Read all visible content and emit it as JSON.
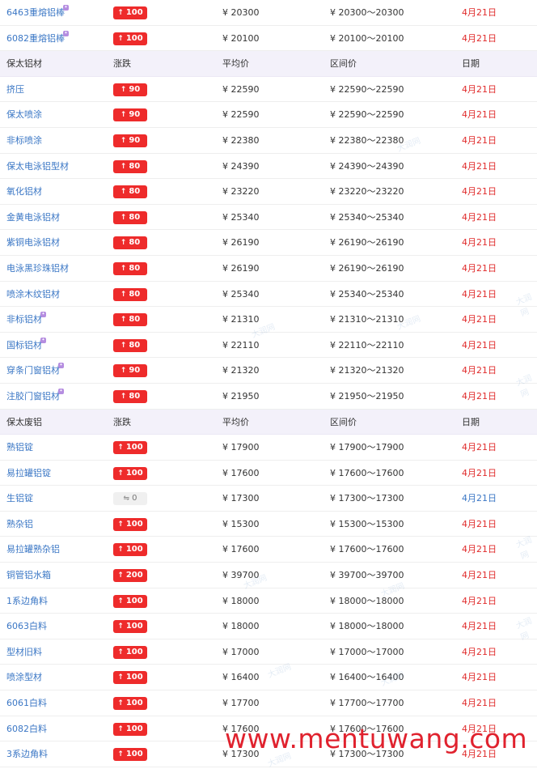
{
  "groups": [
    {
      "header": null,
      "rows": [
        {
          "name": "6463重熔铝棒",
          "vip": true,
          "change": "100",
          "dir": "up",
          "avg": "¥ 20300",
          "range": "¥ 20300～20300",
          "date": "4月21日"
        },
        {
          "name": "6082重熔铝棒",
          "vip": true,
          "change": "100",
          "dir": "up",
          "avg": "¥ 20100",
          "range": "¥ 20100～20100",
          "date": "4月21日"
        }
      ]
    },
    {
      "header": {
        "name": "保太铝材",
        "change": "涨跌",
        "avg": "平均价",
        "range": "区间价",
        "date": "日期"
      },
      "rows": [
        {
          "name": "挤压",
          "vip": false,
          "change": "90",
          "dir": "up",
          "avg": "¥ 22590",
          "range": "¥ 22590～22590",
          "date": "4月21日"
        },
        {
          "name": "保太喷涂",
          "vip": false,
          "change": "90",
          "dir": "up",
          "avg": "¥ 22590",
          "range": "¥ 22590～22590",
          "date": "4月21日"
        },
        {
          "name": "非标喷涂",
          "vip": false,
          "change": "90",
          "dir": "up",
          "avg": "¥ 22380",
          "range": "¥ 22380～22380",
          "date": "4月21日"
        },
        {
          "name": "保太电泳铝型材",
          "vip": false,
          "change": "80",
          "dir": "up",
          "avg": "¥ 24390",
          "range": "¥ 24390～24390",
          "date": "4月21日"
        },
        {
          "name": "氧化铝材",
          "vip": false,
          "change": "80",
          "dir": "up",
          "avg": "¥ 23220",
          "range": "¥ 23220～23220",
          "date": "4月21日"
        },
        {
          "name": "金黄电泳铝材",
          "vip": false,
          "change": "80",
          "dir": "up",
          "avg": "¥ 25340",
          "range": "¥ 25340～25340",
          "date": "4月21日"
        },
        {
          "name": "紫铜电泳铝材",
          "vip": false,
          "change": "80",
          "dir": "up",
          "avg": "¥ 26190",
          "range": "¥ 26190～26190",
          "date": "4月21日"
        },
        {
          "name": "电泳黑珍珠铝材",
          "vip": false,
          "change": "80",
          "dir": "up",
          "avg": "¥ 26190",
          "range": "¥ 26190～26190",
          "date": "4月21日"
        },
        {
          "name": "喷涂木纹铝材",
          "vip": false,
          "change": "80",
          "dir": "up",
          "avg": "¥ 25340",
          "range": "¥ 25340～25340",
          "date": "4月21日"
        },
        {
          "name": "非标铝材",
          "vip": true,
          "change": "80",
          "dir": "up",
          "avg": "¥ 21310",
          "range": "¥ 21310～21310",
          "date": "4月21日"
        },
        {
          "name": "国标铝材",
          "vip": true,
          "change": "80",
          "dir": "up",
          "avg": "¥ 22110",
          "range": "¥ 22110～22110",
          "date": "4月21日"
        },
        {
          "name": "穿条门窗铝材",
          "vip": true,
          "change": "90",
          "dir": "up",
          "avg": "¥ 21320",
          "range": "¥ 21320～21320",
          "date": "4月21日"
        },
        {
          "name": "注胶门窗铝材",
          "vip": true,
          "change": "80",
          "dir": "up",
          "avg": "¥ 21950",
          "range": "¥ 21950～21950",
          "date": "4月21日"
        }
      ]
    },
    {
      "header": {
        "name": "保太废铝",
        "change": "涨跌",
        "avg": "平均价",
        "range": "区间价",
        "date": "日期"
      },
      "rows": [
        {
          "name": "熟铝锭",
          "vip": false,
          "change": "100",
          "dir": "up",
          "avg": "¥ 17900",
          "range": "¥ 17900～17900",
          "date": "4月21日"
        },
        {
          "name": "易拉罐铝锭",
          "vip": false,
          "change": "100",
          "dir": "up",
          "avg": "¥ 17600",
          "range": "¥ 17600～17600",
          "date": "4月21日"
        },
        {
          "name": "生铝锭",
          "vip": false,
          "change": "0",
          "dir": "flat",
          "avg": "¥ 17300",
          "range": "¥ 17300～17300",
          "date": "4月21日"
        },
        {
          "name": "熟杂铝",
          "vip": false,
          "change": "100",
          "dir": "up",
          "avg": "¥ 15300",
          "range": "¥ 15300～15300",
          "date": "4月21日"
        },
        {
          "name": "易拉罐熟杂铝",
          "vip": false,
          "change": "100",
          "dir": "up",
          "avg": "¥ 17600",
          "range": "¥ 17600～17600",
          "date": "4月21日"
        },
        {
          "name": "铜管铝水箱",
          "vip": false,
          "change": "200",
          "dir": "up",
          "avg": "¥ 39700",
          "range": "¥ 39700～39700",
          "date": "4月21日"
        },
        {
          "name": "1系边角料",
          "vip": false,
          "change": "100",
          "dir": "up",
          "avg": "¥ 18000",
          "range": "¥ 18000～18000",
          "date": "4月21日"
        },
        {
          "name": "6063白料",
          "vip": false,
          "change": "100",
          "dir": "up",
          "avg": "¥ 18000",
          "range": "¥ 18000～18000",
          "date": "4月21日"
        },
        {
          "name": "型材旧料",
          "vip": false,
          "change": "100",
          "dir": "up",
          "avg": "¥ 17000",
          "range": "¥ 17000～17000",
          "date": "4月21日"
        },
        {
          "name": "喷涂型材",
          "vip": false,
          "change": "100",
          "dir": "up",
          "avg": "¥ 16400",
          "range": "¥ 16400～16400",
          "date": "4月21日"
        },
        {
          "name": "6061白料",
          "vip": false,
          "change": "100",
          "dir": "up",
          "avg": "¥ 17700",
          "range": "¥ 17700～17700",
          "date": "4月21日"
        },
        {
          "name": "6082白料",
          "vip": false,
          "change": "100",
          "dir": "up",
          "avg": "¥ 17600",
          "range": "¥ 17600～17600",
          "date": "4月21日"
        },
        {
          "name": "3系边角料",
          "vip": false,
          "change": "100",
          "dir": "up",
          "avg": "¥ 17300",
          "range": "¥ 17300～17300",
          "date": "4月21日"
        }
      ]
    }
  ],
  "icons": {
    "up": "arrow-up-icon",
    "flat": "flat-trend-icon",
    "vip": "vip-badge-icon"
  },
  "colors": {
    "up_badge": "#ee2b2b",
    "flat_badge": "#f0f0f0",
    "date_up": "#e02b2b",
    "date_flat": "#3b77c5",
    "link": "#3b77c5",
    "header_bg": "#f3f1fa"
  },
  "watermark": {
    "text": "大润网"
  },
  "footer_watermark": "www.mentuwang.com"
}
